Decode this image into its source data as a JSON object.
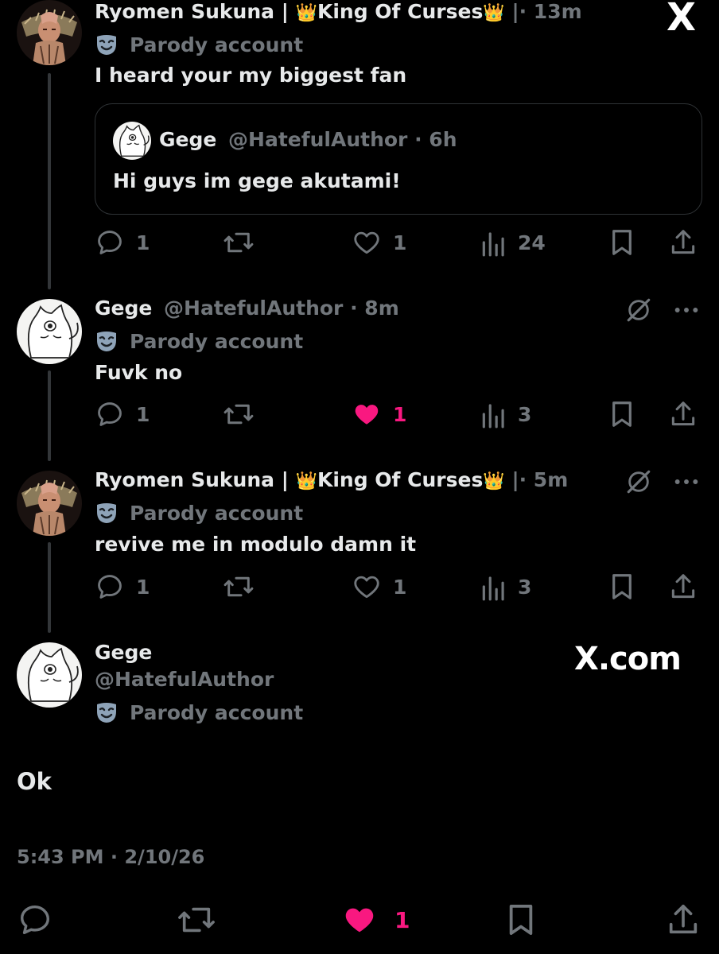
{
  "brand": {
    "logo_letter": "X",
    "watermark": "X.com"
  },
  "colors": {
    "background": "#000000",
    "text": "#e7e9ea",
    "muted": "#71767b",
    "like_active": "#f91880",
    "border": "#2f3336"
  },
  "parody_label": "Parody account",
  "posts": [
    {
      "author_name": "Ryomen Sukuna |",
      "author_title": "King Of Curses",
      "separator": "|",
      "time": "· 13m",
      "text": "I heard your my biggest fan",
      "quote": {
        "author_name": "Gege",
        "handle": "@HatefulAuthor",
        "time": "· 6h",
        "text": "Hi guys im gege akutami!"
      },
      "actions": {
        "replies": "1",
        "reposts": "",
        "likes": "1",
        "liked": false,
        "views": "24"
      }
    },
    {
      "author_name": "Gege",
      "handle": "@HatefulAuthor",
      "time": "· 8m",
      "text": "Fuvk no",
      "actions": {
        "replies": "1",
        "reposts": "",
        "likes": "1",
        "liked": true,
        "views": "3"
      }
    },
    {
      "author_name": "Ryomen Sukuna |",
      "author_title": "King Of Curses",
      "separator": "|",
      "time": "· 5m",
      "text": "revive me in modulo damn it",
      "actions": {
        "replies": "1",
        "reposts": "",
        "likes": "1",
        "liked": false,
        "views": "3"
      }
    }
  ],
  "main_post": {
    "author_name": "Gege",
    "handle": "@HatefulAuthor",
    "text": "Ok",
    "timestamp": "5:43 PM · 2/10/26",
    "actions": {
      "likes": "1",
      "liked": true
    }
  }
}
